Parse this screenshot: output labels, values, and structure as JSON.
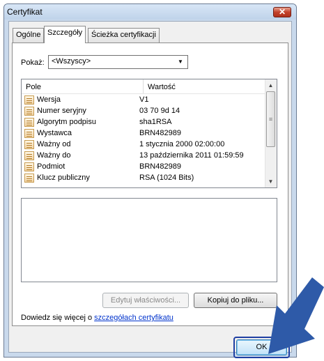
{
  "window": {
    "title": "Certyfikat",
    "close_label": "✕"
  },
  "tabs": [
    {
      "label": "Ogólne",
      "active": false
    },
    {
      "label": "Szczegóły",
      "active": true
    },
    {
      "label": "Ścieżka certyfikacji",
      "active": false
    }
  ],
  "filter": {
    "label": "Pokaż:",
    "value": "<Wszyscy>"
  },
  "list": {
    "columns": {
      "field": "Pole",
      "value": "Wartość"
    },
    "rows": [
      {
        "field": "Wersja",
        "value": "V1"
      },
      {
        "field": "Numer seryjny",
        "value": "03 70 9d 14"
      },
      {
        "field": "Algorytm podpisu",
        "value": "sha1RSA"
      },
      {
        "field": "Wystawca",
        "value": "BRN482989"
      },
      {
        "field": "Ważny od",
        "value": "1 stycznia 2000 02:00:00"
      },
      {
        "field": "Ważny do",
        "value": "13 października 2011 01:59:59"
      },
      {
        "field": "Podmiot",
        "value": "BRN482989"
      },
      {
        "field": "Klucz publiczny",
        "value": "RSA (1024 Bits)"
      }
    ]
  },
  "buttons": {
    "edit_properties": "Edytuj właściwości...",
    "copy_to_file": "Kopiuj do pliku...",
    "ok": "OK"
  },
  "learn_more": {
    "prefix": "Dowiedz się więcej o ",
    "link": "szczegółach certyfikatu"
  },
  "colors": {
    "arrow": "#2e5aa8",
    "link": "#0033cc"
  }
}
